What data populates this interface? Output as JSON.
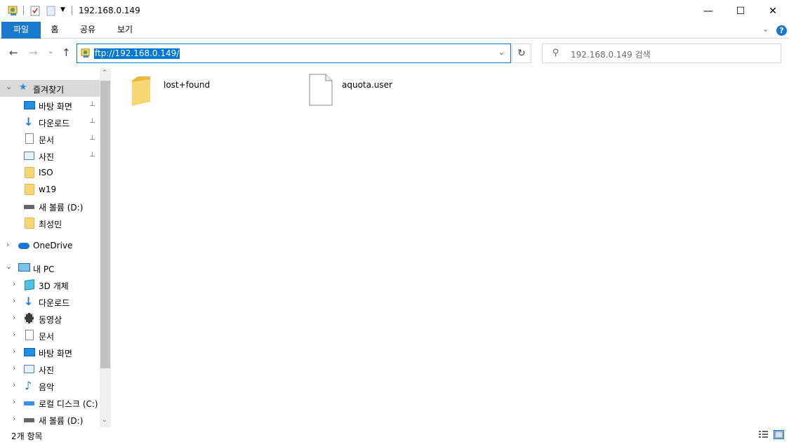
{
  "window": {
    "title": "192.168.0.149",
    "minimize_glyph": "—",
    "maximize_glyph": "☐",
    "close_glyph": "✕"
  },
  "ribbon": {
    "tabs": [
      "파일",
      "홈",
      "공유",
      "보기"
    ],
    "expand_glyph": "⌄",
    "help_glyph": "?"
  },
  "address": {
    "back_glyph": "←",
    "forward_glyph": "→",
    "recent_glyph": "⌄",
    "up_glyph": "↑",
    "path": "ftp://192.168.0.149/",
    "dropdown_glyph": "⌄",
    "refresh_glyph": "↻"
  },
  "search": {
    "placeholder": "192.168.0.149 검색",
    "icon_glyph": "⚲"
  },
  "nav": {
    "quick_access": "즐겨찾기",
    "quick_items": [
      "바탕 화면",
      "다운로드",
      "문서",
      "사진",
      "ISO",
      "w19",
      "새 볼륨 (D:)",
      "최성민"
    ],
    "onedrive": "OneDrive",
    "this_pc": "내 PC",
    "pc_items": [
      "3D 개체",
      "다운로드",
      "동영상",
      "문서",
      "바탕 화면",
      "사진",
      "음악",
      "로컬 디스크 (C:)",
      "새 볼륨 (D:)"
    ],
    "expand_glyph": "›",
    "collapse_glyph": "⌄",
    "pin_glyph": "📌",
    "star_glyph": "★",
    "music_glyph": "♪",
    "scroll_up_glyph": "⌃",
    "scroll_down_glyph": "⌄"
  },
  "files": [
    {
      "name": "lost+found",
      "type": "folder"
    },
    {
      "name": "aquota.user",
      "type": "file"
    }
  ],
  "status": {
    "item_count": "2개 항목"
  },
  "colors": {
    "accent": "#1979ca",
    "selection": "#0078d7",
    "nav_selected": "#d9d9d9",
    "help": "#1979ca"
  }
}
